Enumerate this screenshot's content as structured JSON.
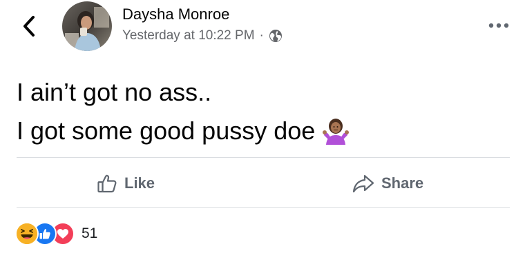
{
  "post": {
    "author": "Daysha Monroe",
    "timestamp": "Yesterday at 10:22 PM",
    "separator": "·",
    "privacy_icon": "globe-icon",
    "text_lines": [
      "I ain’t got no ass..",
      "I got some good pussy doe"
    ],
    "emoji": "person-shrugging-emoji"
  },
  "actions": {
    "like_label": "Like",
    "share_label": "Share"
  },
  "reactions": {
    "types": [
      "haha",
      "like",
      "love"
    ],
    "count": "51"
  },
  "colors": {
    "like_blue": "#1877f2",
    "love_red": "#f33e58",
    "haha_yellow": "#f7b125",
    "secondary_text": "#65676b"
  }
}
